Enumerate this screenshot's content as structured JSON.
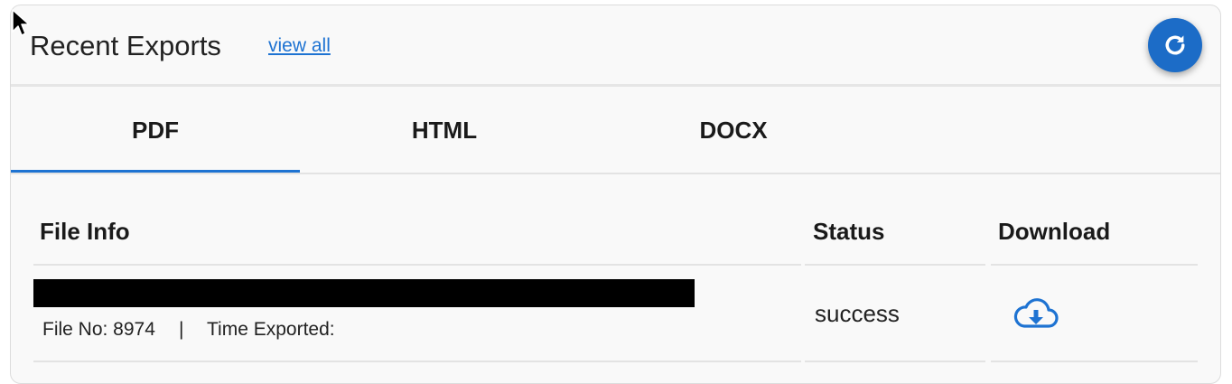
{
  "header": {
    "title": "Recent Exports",
    "view_all": "view all"
  },
  "tabs": [
    {
      "label": "PDF",
      "active": true
    },
    {
      "label": "HTML",
      "active": false
    },
    {
      "label": "DOCX",
      "active": false
    }
  ],
  "table": {
    "columns": [
      "File Info",
      "Status",
      "Download"
    ],
    "rows": [
      {
        "file_name": "",
        "file_no_label": "File No: 8974",
        "separator": "|",
        "time_label": "Time Exported:",
        "status": "success",
        "download_icon": "cloud-download-icon"
      }
    ]
  },
  "icons": {
    "refresh": "refresh-icon",
    "cursor": "mouse-pointer-icon"
  },
  "colors": {
    "accent": "#1e73d2",
    "button": "#1c6cc7",
    "panel_bg": "#f9f9f9"
  }
}
